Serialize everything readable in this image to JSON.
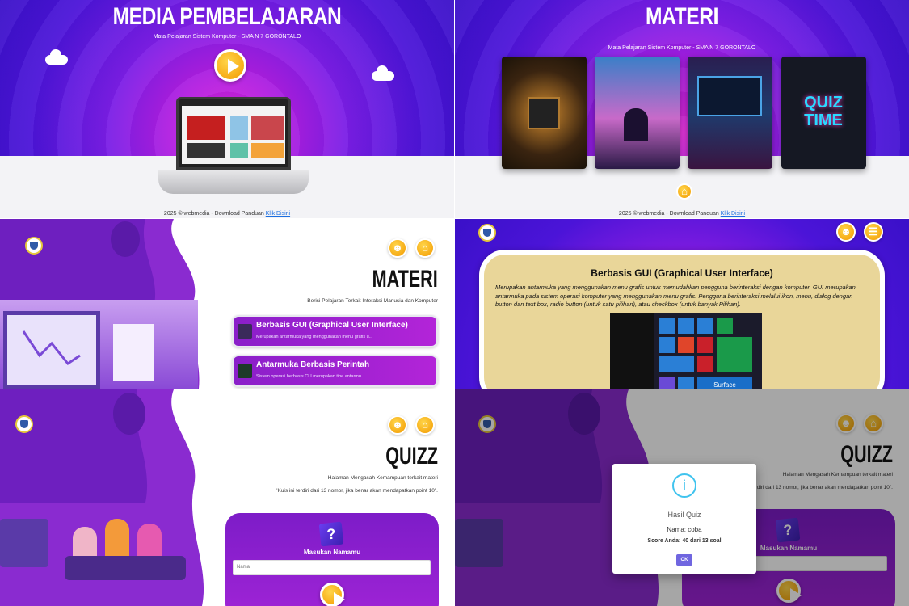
{
  "home": {
    "title": "MEDIA PEMBELAJARAN",
    "subtitle": "Mata Pelajaran Sistem Komputer - SMA N 7 GORONTALO"
  },
  "materi_cover": {
    "title": "MATERI",
    "subtitle": "Mata Pelajaran Sistem Komputer - SMA N 7 GORONTALO",
    "card4_text": "QUIZ TIME"
  },
  "footer": {
    "text": "2025 © webmedia - Download Panduan",
    "link": "Klik Disini"
  },
  "materi_list": {
    "title": "MATERI",
    "subtitle": "Berisi Pelajaran Terkait Interaksi Manusia dan Komputer",
    "items": [
      {
        "title": "Berbasis GUI (Graphical User Interface)",
        "desc": "Merupakan antarmuka yang menggunakan menu grafis u..."
      },
      {
        "title": "Antarmuka Berbasis Perintah",
        "desc": "Sistem operasi berbasis CLI merupakan tipe antarmu..."
      }
    ]
  },
  "detail": {
    "title": "Berbasis GUI (Graphical User Interface)",
    "body": "Merupakan antarmuka yang menggunakan menu grafis untuk memudahkan pengguna berinteraksi dengan komputer. GUI merupakan antarmuka pada sistem operasi komputer yang menggunakan menu grafis. Pengguna berinteraksi melalui ikon, menu, dialog dengan button dan text box, radio button (untuk satu pilihan), atau checkbox (untuk banyak Pilihan).",
    "tile_label": "Surface"
  },
  "quiz": {
    "title": "QUIZZ",
    "subtitle": "Halaman Mengasah Kemampuan terkait materi",
    "rule": "\"Kuis ini terdiri dari 13 nomor, jika benar akan mendapatkan point 10\".",
    "input_label": "Masukan Namamu",
    "input_placeholder": "Nama"
  },
  "result": {
    "title": "Hasil Quiz",
    "name": "Nama: coba",
    "score": "Score Anda: 40 dari 13 soal",
    "ok": "OK"
  },
  "colors": {
    "accent": "#f39a00",
    "purple": "#8a1fc9",
    "indigo": "#3a10c8"
  }
}
